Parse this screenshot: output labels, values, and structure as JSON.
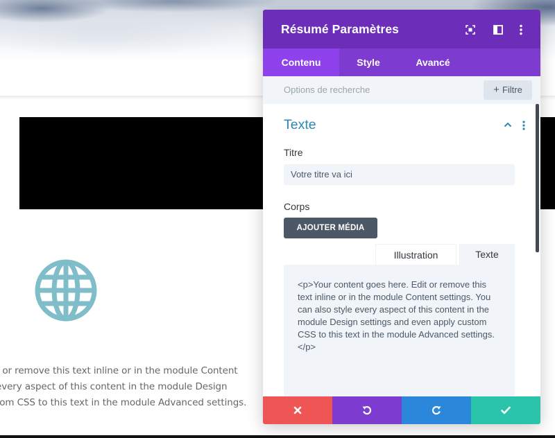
{
  "page": {
    "body_lines": [
      "t or remove this text inline or in the module Content",
      "every aspect of this content in the module Design",
      "tom CSS to this text in the module Advanced settings."
    ]
  },
  "panel": {
    "title": "Résumé Paramètres",
    "header_icons": [
      "fullscreen-icon",
      "split-view-icon",
      "more-options-icon"
    ],
    "tabs": [
      {
        "label": "Contenu",
        "active": true
      },
      {
        "label": "Style",
        "active": false
      },
      {
        "label": "Avancé",
        "active": false
      }
    ],
    "search": {
      "placeholder": "Options de recherche",
      "filter_label": "Filtre"
    },
    "section": {
      "title": "Texte",
      "title_field": {
        "label": "Titre",
        "value": "Votre titre va ici"
      },
      "body_field": {
        "label": "Corps",
        "media_button": "AJOUTER MÉDIA",
        "editor_tabs": [
          "Illustration",
          "Texte"
        ],
        "active_editor_tab": "Texte",
        "content": "<p>Your content goes here. Edit or remove this text inline or in the module Content settings. You can also style every aspect of this content in the module Design settings and even apply custom CSS to this text in the module Advanced settings.</p>"
      }
    },
    "footer_buttons": [
      {
        "name": "cancel",
        "icon": "close-icon",
        "color": "#ef5555"
      },
      {
        "name": "undo",
        "icon": "undo-icon",
        "color": "#7e3bd0"
      },
      {
        "name": "redo",
        "icon": "redo-icon",
        "color": "#2b87da"
      },
      {
        "name": "save",
        "icon": "check-icon",
        "color": "#29c4a9"
      }
    ]
  },
  "colors": {
    "header": "#6c2eb9",
    "tabs": "#7e3bd0",
    "active_tab": "#8f42ec",
    "section_title": "#2b87b3",
    "globe_icon": "#7fbec8"
  }
}
